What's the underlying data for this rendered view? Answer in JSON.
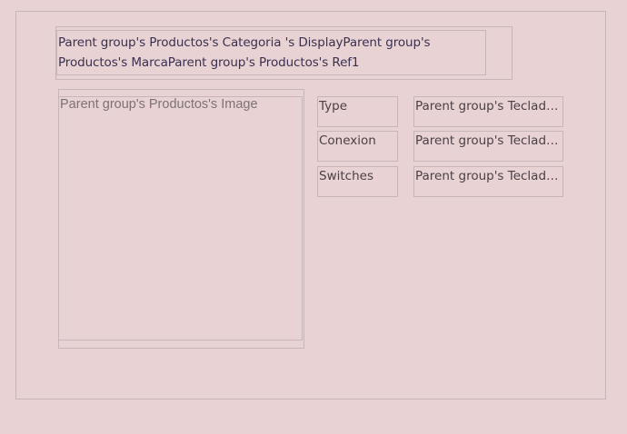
{
  "header": {
    "title": "Parent group's Productos's Categoria 's DisplayParent group's Productos's MarcaParent group's Productos's Ref1"
  },
  "image": {
    "placeholder": "Parent group's Productos's Image"
  },
  "specs": [
    {
      "label": "Type",
      "value": "Parent group's Teclado's..."
    },
    {
      "label": "Conexion",
      "value": "Parent group's Teclado's..."
    },
    {
      "label": "Switches",
      "value": "Parent group's Teclado's..."
    }
  ]
}
